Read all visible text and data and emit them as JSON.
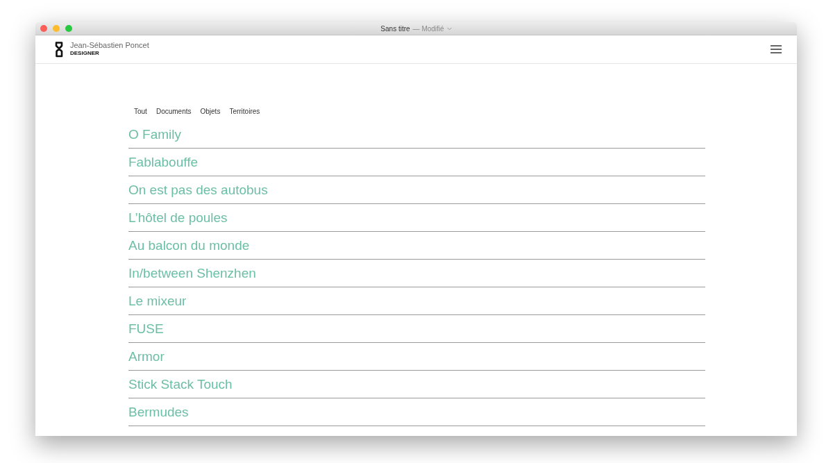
{
  "window": {
    "title": "Sans titre",
    "status": "— Modifié"
  },
  "header": {
    "name": "Jean-Sébastien Poncet",
    "role": "DESIGNER"
  },
  "filters": [
    "Tout",
    "Documents",
    "Objets",
    "Territoires"
  ],
  "projects": [
    "O Family",
    "Fablabouffe",
    "On est pas des autobus",
    "L’hôtel de poules",
    "Au balcon du monde",
    "In/between Shenzhen",
    "Le mixeur",
    "FUSE",
    "Armor",
    "Stick Stack Touch",
    "Bermudes"
  ]
}
